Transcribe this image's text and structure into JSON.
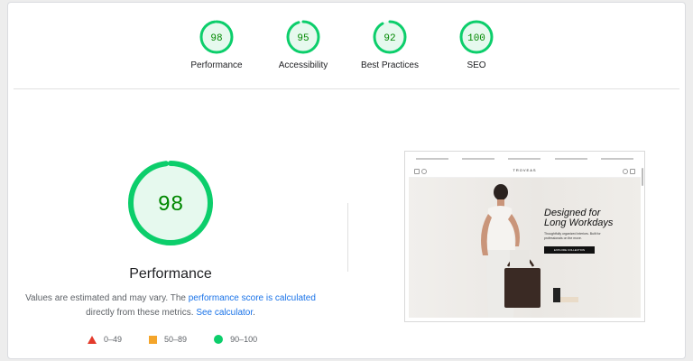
{
  "categories": [
    {
      "label": "Performance",
      "score": "98"
    },
    {
      "label": "Accessibility",
      "score": "95"
    },
    {
      "label": "Best Practices",
      "score": "92"
    },
    {
      "label": "SEO",
      "score": "100"
    }
  ],
  "main": {
    "score": "98",
    "title": "Performance",
    "note_prefix": "Values are estimated and may vary. The ",
    "note_link": "performance score is calculated",
    "note_mid": "directly from these metrics. ",
    "note_link2": "See calculator",
    "note_end": "."
  },
  "legend": {
    "fail": "0–49",
    "average": "50–89",
    "pass": "90–100"
  },
  "screenshot": {
    "brand": "TROVEAS",
    "headline_line1": "Designed for",
    "headline_line2": "Long Workdays",
    "subtext": "Thoughtfully organized interiors. Built for professionals on the move.",
    "cta": "EXPLORE COLLECTION"
  },
  "colors": {
    "pass": "#0cce6b",
    "pass_text": "#008800",
    "pass_bg": "#e6f9ee",
    "average": "#f4a52b",
    "fail": "#e33a2b",
    "link": "#1a73e8"
  }
}
